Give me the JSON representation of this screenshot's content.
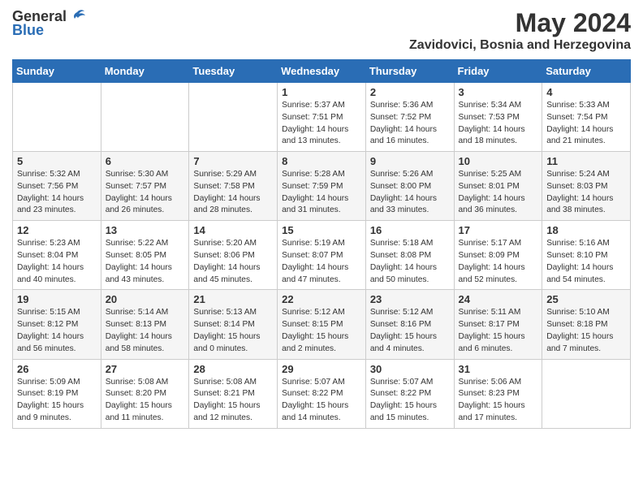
{
  "logo": {
    "general": "General",
    "blue": "Blue"
  },
  "title": {
    "month_year": "May 2024",
    "location": "Zavidovici, Bosnia and Herzegovina"
  },
  "headers": [
    "Sunday",
    "Monday",
    "Tuesday",
    "Wednesday",
    "Thursday",
    "Friday",
    "Saturday"
  ],
  "weeks": [
    [
      {
        "day": "",
        "info": ""
      },
      {
        "day": "",
        "info": ""
      },
      {
        "day": "",
        "info": ""
      },
      {
        "day": "1",
        "info": "Sunrise: 5:37 AM\nSunset: 7:51 PM\nDaylight: 14 hours\nand 13 minutes."
      },
      {
        "day": "2",
        "info": "Sunrise: 5:36 AM\nSunset: 7:52 PM\nDaylight: 14 hours\nand 16 minutes."
      },
      {
        "day": "3",
        "info": "Sunrise: 5:34 AM\nSunset: 7:53 PM\nDaylight: 14 hours\nand 18 minutes."
      },
      {
        "day": "4",
        "info": "Sunrise: 5:33 AM\nSunset: 7:54 PM\nDaylight: 14 hours\nand 21 minutes."
      }
    ],
    [
      {
        "day": "5",
        "info": "Sunrise: 5:32 AM\nSunset: 7:56 PM\nDaylight: 14 hours\nand 23 minutes."
      },
      {
        "day": "6",
        "info": "Sunrise: 5:30 AM\nSunset: 7:57 PM\nDaylight: 14 hours\nand 26 minutes."
      },
      {
        "day": "7",
        "info": "Sunrise: 5:29 AM\nSunset: 7:58 PM\nDaylight: 14 hours\nand 28 minutes."
      },
      {
        "day": "8",
        "info": "Sunrise: 5:28 AM\nSunset: 7:59 PM\nDaylight: 14 hours\nand 31 minutes."
      },
      {
        "day": "9",
        "info": "Sunrise: 5:26 AM\nSunset: 8:00 PM\nDaylight: 14 hours\nand 33 minutes."
      },
      {
        "day": "10",
        "info": "Sunrise: 5:25 AM\nSunset: 8:01 PM\nDaylight: 14 hours\nand 36 minutes."
      },
      {
        "day": "11",
        "info": "Sunrise: 5:24 AM\nSunset: 8:03 PM\nDaylight: 14 hours\nand 38 minutes."
      }
    ],
    [
      {
        "day": "12",
        "info": "Sunrise: 5:23 AM\nSunset: 8:04 PM\nDaylight: 14 hours\nand 40 minutes."
      },
      {
        "day": "13",
        "info": "Sunrise: 5:22 AM\nSunset: 8:05 PM\nDaylight: 14 hours\nand 43 minutes."
      },
      {
        "day": "14",
        "info": "Sunrise: 5:20 AM\nSunset: 8:06 PM\nDaylight: 14 hours\nand 45 minutes."
      },
      {
        "day": "15",
        "info": "Sunrise: 5:19 AM\nSunset: 8:07 PM\nDaylight: 14 hours\nand 47 minutes."
      },
      {
        "day": "16",
        "info": "Sunrise: 5:18 AM\nSunset: 8:08 PM\nDaylight: 14 hours\nand 50 minutes."
      },
      {
        "day": "17",
        "info": "Sunrise: 5:17 AM\nSunset: 8:09 PM\nDaylight: 14 hours\nand 52 minutes."
      },
      {
        "day": "18",
        "info": "Sunrise: 5:16 AM\nSunset: 8:10 PM\nDaylight: 14 hours\nand 54 minutes."
      }
    ],
    [
      {
        "day": "19",
        "info": "Sunrise: 5:15 AM\nSunset: 8:12 PM\nDaylight: 14 hours\nand 56 minutes."
      },
      {
        "day": "20",
        "info": "Sunrise: 5:14 AM\nSunset: 8:13 PM\nDaylight: 14 hours\nand 58 minutes."
      },
      {
        "day": "21",
        "info": "Sunrise: 5:13 AM\nSunset: 8:14 PM\nDaylight: 15 hours\nand 0 minutes."
      },
      {
        "day": "22",
        "info": "Sunrise: 5:12 AM\nSunset: 8:15 PM\nDaylight: 15 hours\nand 2 minutes."
      },
      {
        "day": "23",
        "info": "Sunrise: 5:12 AM\nSunset: 8:16 PM\nDaylight: 15 hours\nand 4 minutes."
      },
      {
        "day": "24",
        "info": "Sunrise: 5:11 AM\nSunset: 8:17 PM\nDaylight: 15 hours\nand 6 minutes."
      },
      {
        "day": "25",
        "info": "Sunrise: 5:10 AM\nSunset: 8:18 PM\nDaylight: 15 hours\nand 7 minutes."
      }
    ],
    [
      {
        "day": "26",
        "info": "Sunrise: 5:09 AM\nSunset: 8:19 PM\nDaylight: 15 hours\nand 9 minutes."
      },
      {
        "day": "27",
        "info": "Sunrise: 5:08 AM\nSunset: 8:20 PM\nDaylight: 15 hours\nand 11 minutes."
      },
      {
        "day": "28",
        "info": "Sunrise: 5:08 AM\nSunset: 8:21 PM\nDaylight: 15 hours\nand 12 minutes."
      },
      {
        "day": "29",
        "info": "Sunrise: 5:07 AM\nSunset: 8:22 PM\nDaylight: 15 hours\nand 14 minutes."
      },
      {
        "day": "30",
        "info": "Sunrise: 5:07 AM\nSunset: 8:22 PM\nDaylight: 15 hours\nand 15 minutes."
      },
      {
        "day": "31",
        "info": "Sunrise: 5:06 AM\nSunset: 8:23 PM\nDaylight: 15 hours\nand 17 minutes."
      },
      {
        "day": "",
        "info": ""
      }
    ]
  ]
}
